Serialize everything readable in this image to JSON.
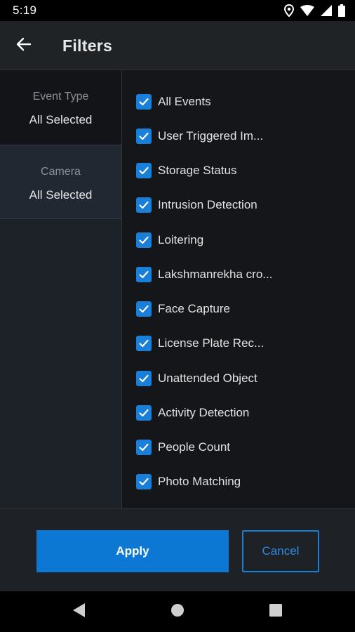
{
  "status_bar": {
    "time": "5:19",
    "icons": [
      "location-icon",
      "wifi-icon",
      "signal-icon",
      "battery-icon"
    ]
  },
  "app_bar": {
    "title": "Filters",
    "back_icon": "arrow-left-icon"
  },
  "categories": [
    {
      "label": "Event Type",
      "value": "All Selected",
      "active": true
    },
    {
      "label": "Camera",
      "value": "All Selected",
      "active": false
    }
  ],
  "options": [
    {
      "label": "All Events",
      "checked": true
    },
    {
      "label": "User Triggered Im...",
      "checked": true
    },
    {
      "label": "Storage Status",
      "checked": true
    },
    {
      "label": "Intrusion Detection",
      "checked": true
    },
    {
      "label": "Loitering",
      "checked": true
    },
    {
      "label": "Lakshmanrekha cro...",
      "checked": true
    },
    {
      "label": "Face Capture",
      "checked": true
    },
    {
      "label": "License Plate Rec...",
      "checked": true
    },
    {
      "label": "Unattended Object",
      "checked": true
    },
    {
      "label": "Activity Detection",
      "checked": true
    },
    {
      "label": "People Count",
      "checked": true
    },
    {
      "label": "Photo Matching",
      "checked": true
    }
  ],
  "actions": {
    "apply_label": "Apply",
    "cancel_label": "Cancel"
  },
  "nav_bar": {
    "icons": [
      "back-triangle-icon",
      "home-circle-icon",
      "recents-square-icon"
    ]
  },
  "colors": {
    "accent": "#1a7fd8",
    "apply_bg": "#0c78d4",
    "text_primary": "#e2e2e2",
    "text_secondary": "#8c9096"
  }
}
